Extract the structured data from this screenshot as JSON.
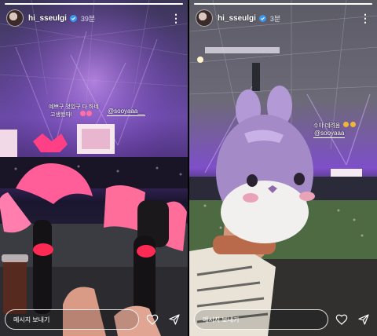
{
  "stories": [
    {
      "username": "hi_sseulgi",
      "time": "39분",
      "progress": 1.0,
      "caption_line1": "예쁘구 멋있구 다 하네",
      "caption_line2": "고생했따!",
      "mention": "@sooyaaa__",
      "message_placeholder": "메시지 보내기",
      "icons": [
        "verified-icon",
        "more-icon",
        "heart-icon",
        "send-icon"
      ]
    },
    {
      "username": "hi_sseulgi",
      "time": "3분",
      "progress": 1.0,
      "caption_line1": "수야 데려옴",
      "mention": "@sooyaaa",
      "message_placeholder": "메시지 보내기",
      "icons": [
        "verified-icon",
        "more-icon",
        "heart-icon",
        "send-icon"
      ]
    }
  ],
  "colors": {
    "accent_purple": "#8a5fd0",
    "verified_blue": "#3897f0",
    "lightstick_pink": "#ff6d9a"
  }
}
